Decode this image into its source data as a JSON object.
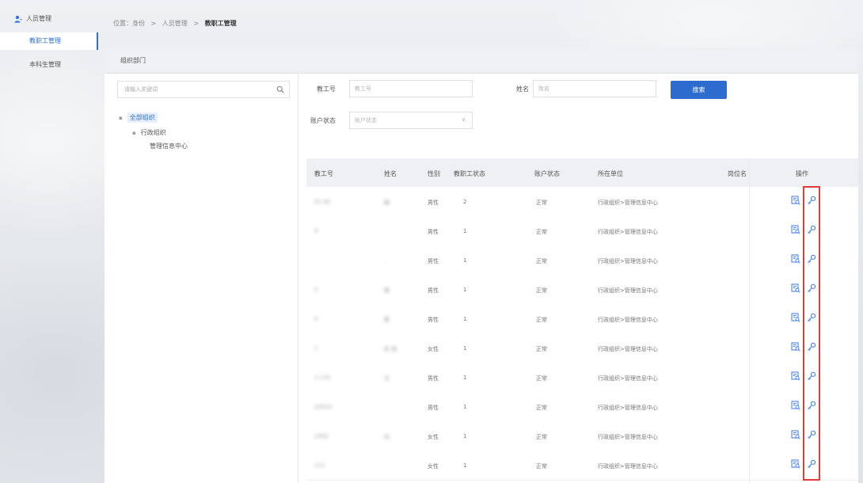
{
  "sidebar": {
    "group_label": "人员管理",
    "items": [
      {
        "label": "教职工管理",
        "active": true
      },
      {
        "label": "本科生管理",
        "active": false
      }
    ]
  },
  "breadcrumb": {
    "prefix": "位置：身份",
    "sep": ">",
    "level1": "人员管理",
    "current": "教职工管理"
  },
  "panel": {
    "header": "组织部门"
  },
  "tree": {
    "search_placeholder": "请输入关键词",
    "nodes": [
      {
        "label": "全部组织",
        "caret": "▪",
        "selected": true
      },
      {
        "label": "行政组织",
        "caret": "▪"
      },
      {
        "label": "管理信息中心"
      }
    ]
  },
  "filters": {
    "staff_no_label": "教工号",
    "staff_no_placeholder": "教工号",
    "name_label": "姓名",
    "name_placeholder": "姓名",
    "account_status_label": "账户状态",
    "account_status_placeholder": "账户状态",
    "dropdown_glyph": "∨",
    "search_button": "搜索"
  },
  "table": {
    "headers": {
      "staff_no": "教工号",
      "name": "姓名",
      "gender": "性别",
      "staff_status": "教职工状态",
      "account_status": "账户状态",
      "unit": "所在单位",
      "position": "岗位名",
      "actions": "操作"
    },
    "rows": [
      {
        "staff_no": "01 40",
        "name": "翰",
        "gender": "男性",
        "staff_status": "2",
        "account_status": "正常",
        "unit": "行政组织>管理信息中心"
      },
      {
        "staff_no": "4",
        "name": "",
        "gender": "男性",
        "staff_status": "1",
        "account_status": "正常",
        "unit": "行政组织>管理信息中心"
      },
      {
        "staff_no": "",
        "name": ",",
        "gender": "男性",
        "staff_status": "1",
        "account_status": "正常",
        "unit": "行政组织>管理信息中心"
      },
      {
        "staff_no": "0",
        "name": "黄",
        "gender": "男性",
        "staff_status": "1",
        "account_status": "正常",
        "unit": "行政组织>管理信息中心"
      },
      {
        "staff_no": "0",
        "name": "蔡 ",
        "gender": "男性",
        "staff_status": "1",
        "account_status": "正常",
        "unit": "行政组织>管理信息中心"
      },
      {
        "staff_no": "1",
        "name": "彭 扬",
        "gender": "女性",
        "staff_status": "1",
        "account_status": "正常",
        "unit": "行政组织>管理信息中心"
      },
      {
        "staff_no": "1 170",
        "name": "玉",
        "gender": "男性",
        "staff_status": "1",
        "account_status": "正常",
        "unit": "行政组织>管理信息中心"
      },
      {
        "staff_no": "23010",
        "name": "",
        "gender": "男性",
        "staff_status": "1",
        "account_status": "正常",
        "unit": "行政组织>管理信息中心"
      },
      {
        "staff_no": "2302",
        "name": "丹",
        "gender": "女性",
        "staff_status": "1",
        "account_status": "正常",
        "unit": "行政组织>管理信息中心"
      },
      {
        "staff_no": "171",
        "name": "",
        "gender": "女性",
        "staff_status": "1",
        "account_status": "正常",
        "unit": "行政组织>管理信息中心"
      }
    ]
  },
  "icons": {
    "view": "view-detail-icon",
    "key": "reset-password-icon",
    "user": "user-icon",
    "search": "search-icon"
  },
  "colors": {
    "primary": "#2d6bcf",
    "highlight_box": "#e23a3a"
  }
}
